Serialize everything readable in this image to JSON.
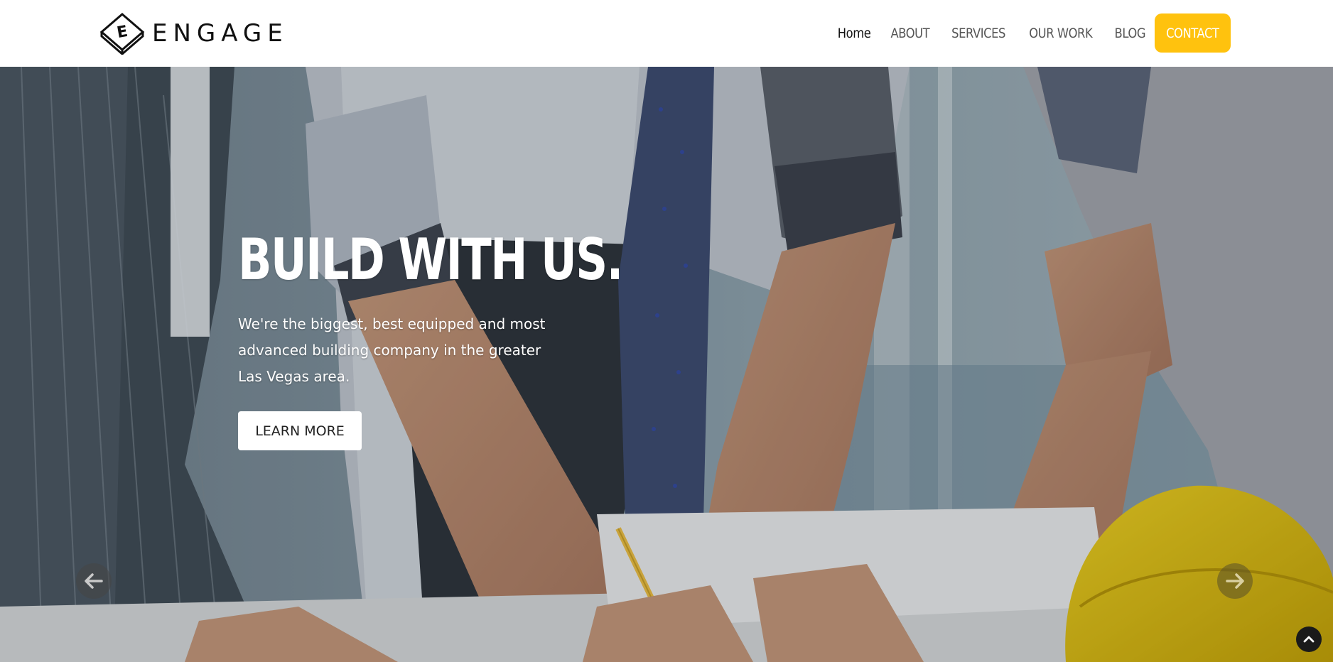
{
  "brand": {
    "name": "ENGAGE",
    "logo_letter": "E"
  },
  "nav": {
    "items": [
      {
        "label": "Home",
        "active": true
      },
      {
        "label": "ABOUT",
        "active": false
      },
      {
        "label": "SERVICES",
        "active": false
      },
      {
        "label": "OUR WORK",
        "active": false
      },
      {
        "label": "BLOG",
        "active": false
      }
    ],
    "contact_label": "CONTACT"
  },
  "hero": {
    "title": "BUILD WITH US.",
    "text": "We're the biggest, best equipped and most advanced building company in the greater Las Vegas area.",
    "button_label": "LEARN MORE",
    "prev_icon": "arrow-left-icon",
    "next_icon": "arrow-right-icon"
  },
  "scroll_top_icon": "chevron-up-icon",
  "colors": {
    "accent": "#ffc20e",
    "text_dark": "#111111",
    "nav_text": "#555555",
    "hero_text": "#ffffff"
  }
}
